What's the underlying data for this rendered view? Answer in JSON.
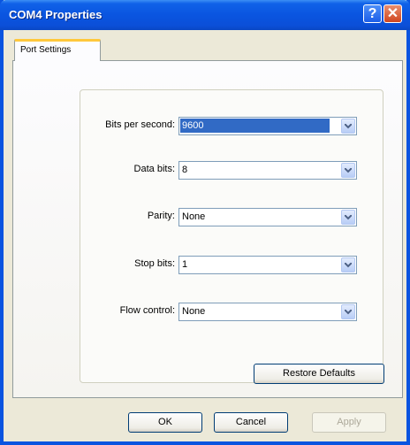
{
  "window": {
    "title": "COM4 Properties"
  },
  "titlebar": {
    "help_glyph": "?",
    "close_glyph": "✕"
  },
  "tabs": [
    {
      "label": "Port Settings",
      "active": true
    }
  ],
  "fields": [
    {
      "label": "Bits per second:",
      "value": "9600",
      "selected": true
    },
    {
      "label": "Data bits:",
      "value": "8",
      "selected": false
    },
    {
      "label": "Parity:",
      "value": "None",
      "selected": false
    },
    {
      "label": "Stop bits:",
      "value": "1",
      "selected": false
    },
    {
      "label": "Flow control:",
      "value": "None",
      "selected": false
    }
  ],
  "restore_defaults": {
    "label": "Restore Defaults"
  },
  "footer": {
    "ok_label": "OK",
    "cancel_label": "Cancel",
    "apply_label": "Apply"
  },
  "colors": {
    "titlebar": "#0a55e0",
    "selection": "#316ac5",
    "tab_highlight": "#ffc83c"
  }
}
